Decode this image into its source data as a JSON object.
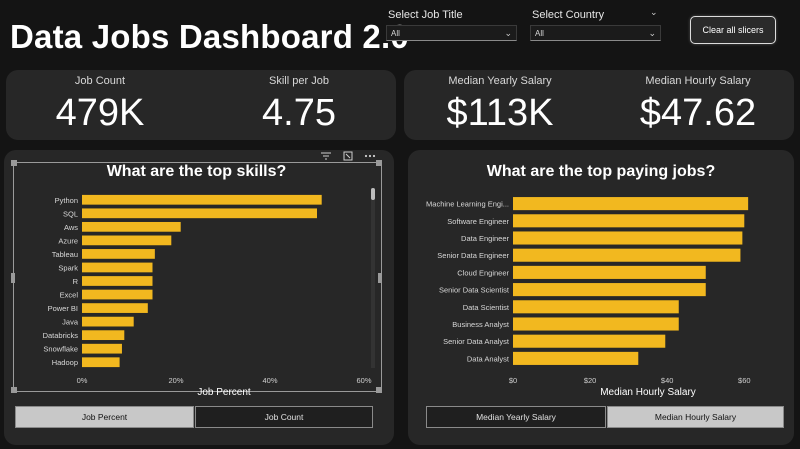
{
  "header": {
    "title": "Data Jobs Dashboard 2.0",
    "slicer_job": {
      "label": "Select Job Title",
      "value": "All"
    },
    "slicer_country": {
      "label": "Select Country",
      "value": "All"
    },
    "clear_button": "Clear all slicers"
  },
  "kpis": [
    {
      "label": "Job Count",
      "value": "479K"
    },
    {
      "label": "Skill per Job",
      "value": "4.75"
    },
    {
      "label": "Median Yearly Salary",
      "value": "$113K"
    },
    {
      "label": "Median Hourly Salary",
      "value": "$47.62"
    }
  ],
  "skills_panel": {
    "toggle_on": "Job Percent",
    "toggle_off": "Job Count"
  },
  "jobs_panel": {
    "toggle_off": "Median Yearly Salary",
    "toggle_on": "Median Hourly Salary"
  },
  "colors": {
    "bar": "#f2b81f",
    "card": "#272727",
    "background": "#141414"
  },
  "chart_data": [
    {
      "type": "bar",
      "orientation": "horizontal",
      "title": "What are the top skills?",
      "xlabel": "Job Percent",
      "ylabel": "",
      "categories": [
        "Python",
        "SQL",
        "Aws",
        "Azure",
        "Tableau",
        "Spark",
        "R",
        "Excel",
        "Power BI",
        "Java",
        "Databricks",
        "Snowflake",
        "Hadoop"
      ],
      "values": [
        51,
        50,
        21,
        19,
        15.5,
        15,
        15,
        15,
        14,
        11,
        9,
        8.5,
        8
      ],
      "xlim": [
        0,
        60
      ],
      "xticks": [
        "0%",
        "20%",
        "40%",
        "60%"
      ],
      "grid": false
    },
    {
      "type": "bar",
      "orientation": "horizontal",
      "title": "What are the top paying jobs?",
      "xlabel": "Median Hourly Salary",
      "ylabel": "",
      "categories": [
        "Machine Learning Engi...",
        "Software Engineer",
        "Data Engineer",
        "Senior Data Engineer",
        "Cloud Engineer",
        "Senior Data Scientist",
        "Data Scientist",
        "Business Analyst",
        "Senior Data Analyst",
        "Data Analyst"
      ],
      "values": [
        61,
        60,
        59.5,
        59,
        50,
        50,
        43,
        43,
        39.5,
        32.5
      ],
      "xlim": [
        0,
        62
      ],
      "xticks": [
        "$0",
        "$20",
        "$40",
        "$60"
      ],
      "grid": false
    }
  ]
}
